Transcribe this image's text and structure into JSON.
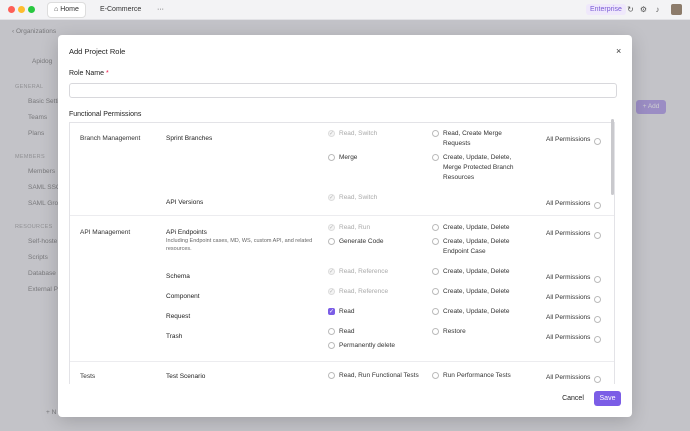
{
  "window": {
    "tabs": [
      {
        "label": "Home",
        "icon": "home-icon"
      },
      {
        "label": "E-Commerce"
      },
      {
        "label": "···"
      }
    ],
    "enterprise": "Enterprise"
  },
  "background": {
    "back_label": "Organizations",
    "org_name": "Apidog",
    "sections": [
      "GENERAL",
      "MEMBERS",
      "RESOURCES"
    ],
    "items": [
      "Basic Setti",
      "Teams",
      "Plans",
      "Members",
      "SAML SSO",
      "SAML Gro",
      "Self-hoste",
      "Scripts",
      "Database",
      "External P"
    ],
    "add_button": "+ Add",
    "new_label": "+ N"
  },
  "modal": {
    "title": "Add Project Role",
    "role_name_label": "Role Name",
    "required_mark": "*",
    "functional_label": "Functional Permissions",
    "cancel": "Cancel",
    "save": "Save",
    "all_permissions": "All Permissions",
    "groups": [
      {
        "name": "Branch Management",
        "rows": [
          {
            "name": "Sprint Branches",
            "opts": [
              {
                "label": "Read, Switch",
                "state": "disabled"
              },
              {
                "label": "Read, Create Merge Requests",
                "state": "off"
              },
              {
                "label": "Merge",
                "state": "off"
              },
              {
                "label": "Create, Update, Delete, Merge Protected Branch Resources",
                "state": "off"
              }
            ]
          },
          {
            "name": "API Versions",
            "opts": [
              {
                "label": "Read, Switch",
                "state": "disabled"
              }
            ]
          }
        ]
      },
      {
        "name": "API Management",
        "rows": [
          {
            "name": "APi Endpoints",
            "desc": "Including Endpoint cases, MD, WS, custom API, and related resources.",
            "opts": [
              {
                "label": "Read, Run",
                "state": "disabled"
              },
              {
                "label": "Create, Update, Delete",
                "state": "off"
              },
              {
                "label": "Generate Code",
                "state": "off"
              },
              {
                "label": "Create, Update, Delete Endpoint Case",
                "state": "off"
              }
            ]
          },
          {
            "name": "Schema",
            "opts": [
              {
                "label": "Read, Reference",
                "state": "disabled"
              },
              {
                "label": "Create, Update, Delete",
                "state": "off"
              }
            ]
          },
          {
            "name": "Component",
            "opts": [
              {
                "label": "Read, Reference",
                "state": "disabled"
              },
              {
                "label": "Create, Update, Delete",
                "state": "off"
              }
            ]
          },
          {
            "name": "Request",
            "opts": [
              {
                "label": "Read",
                "state": "on"
              },
              {
                "label": "Create, Update, Delete",
                "state": "off"
              }
            ]
          },
          {
            "name": "Trash",
            "opts": [
              {
                "label": "Read",
                "state": "off"
              },
              {
                "label": "Restore",
                "state": "off"
              },
              {
                "label": "Permanently delete",
                "state": "off"
              }
            ]
          }
        ]
      },
      {
        "name": "Tests",
        "rows": [
          {
            "name": "Test Scenario",
            "opts": [
              {
                "label": "Read, Run Functional Tests",
                "state": "off"
              },
              {
                "label": "Run Performance Tests",
                "state": "off"
              }
            ]
          }
        ]
      }
    ]
  }
}
